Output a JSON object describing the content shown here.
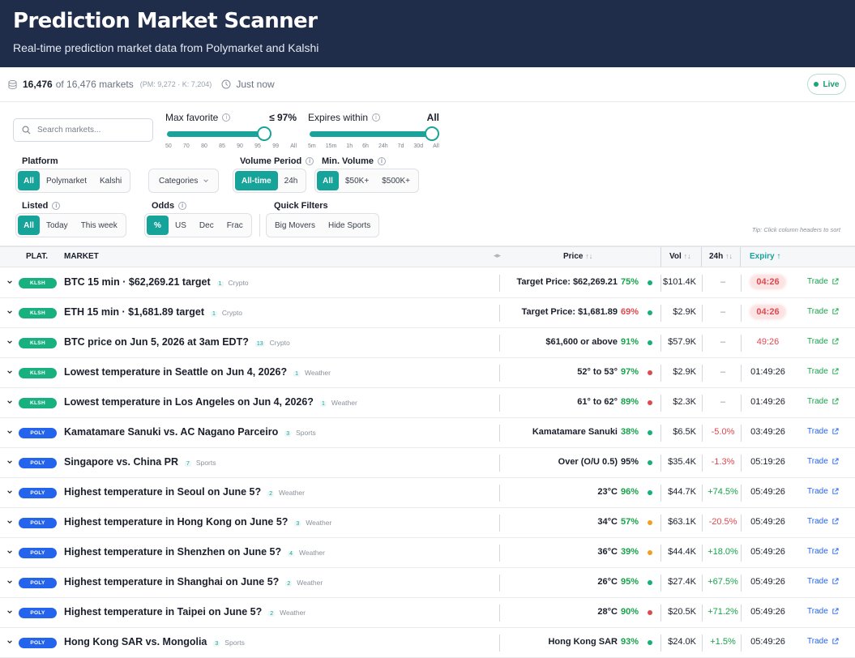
{
  "header": {
    "title": "Prediction Market Scanner",
    "subtitle": "Real-time prediction market data from Polymarket and Kalshi"
  },
  "status": {
    "count": "16,476",
    "total": "of 16,476 markets",
    "split": "(PM: 9,272 · K: 7,204)",
    "updated": "Just now",
    "live_label": "Live"
  },
  "search": {
    "placeholder": "Search markets..."
  },
  "max_favorite": {
    "label": "Max favorite",
    "value": "≤ 97%",
    "ticks": [
      "50",
      "70",
      "80",
      "85",
      "90",
      "95",
      "99",
      "All"
    ]
  },
  "expires_within": {
    "label": "Expires within",
    "value": "All",
    "ticks": [
      "5m",
      "15m",
      "1h",
      "6h",
      "24h",
      "7d",
      "30d",
      "All"
    ]
  },
  "platform": {
    "label": "Platform",
    "options": [
      "All",
      "Polymarket",
      "Kalshi"
    ],
    "selected": "All"
  },
  "categories": {
    "label": "Categories"
  },
  "volume_period": {
    "label": "Volume Period",
    "options": [
      "All-time",
      "24h"
    ],
    "selected": "All-time"
  },
  "min_volume": {
    "label": "Min. Volume",
    "options": [
      "All",
      "$50K+",
      "$500K+"
    ],
    "selected": "All"
  },
  "listed": {
    "label": "Listed",
    "options": [
      "All",
      "Today",
      "This week"
    ],
    "selected": "All"
  },
  "odds": {
    "label": "Odds",
    "options": [
      "%",
      "US",
      "Dec",
      "Frac"
    ],
    "selected": "%"
  },
  "quick_filters": {
    "label": "Quick Filters",
    "options": [
      "Big Movers",
      "Hide Sports"
    ]
  },
  "tip": "Tip: Click column headers to sort",
  "table": {
    "headers": {
      "platform": "PLAT.",
      "market": "MARKET",
      "price": "Price",
      "vol": "Vol",
      "change": "24h",
      "expiry": "Expiry"
    },
    "trade_label": "Trade",
    "rows": [
      {
        "platform": "KLSH",
        "title": "BTC 15 min · $62,269.21 target",
        "count": "1",
        "category": "Crypto",
        "price": "Target Price: $62,269.21",
        "pct": "75%",
        "pct_color": "#16a34a",
        "dot": "#16b07a",
        "vol": "$101.4K",
        "change": "–",
        "expiry": "04:26",
        "expiry_state": "urgent"
      },
      {
        "platform": "KLSH",
        "title": "ETH 15 min · $1,681.89 target",
        "count": "1",
        "category": "Crypto",
        "price": "Target Price: $1,681.89",
        "pct": "69%",
        "pct_color": "#e0484f",
        "dot": "#16b07a",
        "vol": "$2.9K",
        "change": "–",
        "expiry": "04:26",
        "expiry_state": "urgent"
      },
      {
        "platform": "KLSH",
        "title": "BTC price on Jun 5, 2026 at 3am EDT?",
        "count": "13",
        "category": "Crypto",
        "price": "$61,600 or above",
        "pct": "91%",
        "pct_color": "#16a34a",
        "dot": "#16b07a",
        "vol": "$57.9K",
        "change": "–",
        "expiry": "49:26",
        "expiry_state": "warn"
      },
      {
        "platform": "KLSH",
        "title": "Lowest temperature in Seattle on Jun 4, 2026?",
        "count": "1",
        "category": "Weather",
        "price": "52° to 53°",
        "pct": "97%",
        "pct_color": "#16a34a",
        "dot": "#e0484f",
        "vol": "$2.9K",
        "change": "–",
        "expiry": "01:49:26",
        "expiry_state": "normal"
      },
      {
        "platform": "KLSH",
        "title": "Lowest temperature in Los Angeles on Jun 4, 2026?",
        "count": "1",
        "category": "Weather",
        "price": "61° to 62°",
        "pct": "89%",
        "pct_color": "#16a34a",
        "dot": "#e0484f",
        "vol": "$2.3K",
        "change": "–",
        "expiry": "01:49:26",
        "expiry_state": "normal"
      },
      {
        "platform": "POLY",
        "title": "Kamatamare Sanuki vs. AC Nagano Parceiro",
        "count": "3",
        "category": "Sports",
        "price": "Kamatamare Sanuki",
        "pct": "38%",
        "pct_color": "#16a34a",
        "dot": "#16b07a",
        "vol": "$6.5K",
        "change": "-5.0%",
        "change_color": "#e0484f",
        "expiry": "03:49:26",
        "expiry_state": "normal"
      },
      {
        "platform": "POLY",
        "title": "Singapore vs. China PR",
        "count": "7",
        "category": "Sports",
        "price": "Over (O/U 0.5)",
        "pct": "95%",
        "pct_color": "#1a1f2b",
        "dot": "#16b07a",
        "vol": "$35.4K",
        "change": "-1.3%",
        "change_color": "#e0484f",
        "expiry": "05:19:26",
        "expiry_state": "normal"
      },
      {
        "platform": "POLY",
        "title": "Highest temperature in Seoul on June 5?",
        "count": "2",
        "category": "Weather",
        "price": "23°C",
        "pct": "96%",
        "pct_color": "#16a34a",
        "dot": "#16b07a",
        "vol": "$44.7K",
        "change": "+74.5%",
        "change_color": "#16a34a",
        "expiry": "05:49:26",
        "expiry_state": "normal"
      },
      {
        "platform": "POLY",
        "title": "Highest temperature in Hong Kong on June 5?",
        "count": "3",
        "category": "Weather",
        "price": "34°C",
        "pct": "57%",
        "pct_color": "#16a34a",
        "dot": "#f0a020",
        "vol": "$63.1K",
        "change": "-20.5%",
        "change_color": "#e0484f",
        "expiry": "05:49:26",
        "expiry_state": "normal"
      },
      {
        "platform": "POLY",
        "title": "Highest temperature in Shenzhen on June 5?",
        "count": "4",
        "category": "Weather",
        "price": "36°C",
        "pct": "39%",
        "pct_color": "#16a34a",
        "dot": "#f0a020",
        "vol": "$44.4K",
        "change": "+18.0%",
        "change_color": "#16a34a",
        "expiry": "05:49:26",
        "expiry_state": "normal"
      },
      {
        "platform": "POLY",
        "title": "Highest temperature in Shanghai on June 5?",
        "count": "2",
        "category": "Weather",
        "price": "26°C",
        "pct": "95%",
        "pct_color": "#16a34a",
        "dot": "#16b07a",
        "vol": "$27.4K",
        "change": "+67.5%",
        "change_color": "#16a34a",
        "expiry": "05:49:26",
        "expiry_state": "normal"
      },
      {
        "platform": "POLY",
        "title": "Highest temperature in Taipei on June 5?",
        "count": "2",
        "category": "Weather",
        "price": "28°C",
        "pct": "90%",
        "pct_color": "#16a34a",
        "dot": "#e0484f",
        "vol": "$20.5K",
        "change": "+71.2%",
        "change_color": "#16a34a",
        "expiry": "05:49:26",
        "expiry_state": "normal"
      },
      {
        "platform": "POLY",
        "title": "Hong Kong SAR vs. Mongolia",
        "count": "3",
        "category": "Sports",
        "price": "Hong Kong SAR",
        "pct": "93%",
        "pct_color": "#16a34a",
        "dot": "#16b07a",
        "vol": "$24.0K",
        "change": "+1.5%",
        "change_color": "#16a34a",
        "expiry": "05:49:26",
        "expiry_state": "normal"
      }
    ]
  }
}
